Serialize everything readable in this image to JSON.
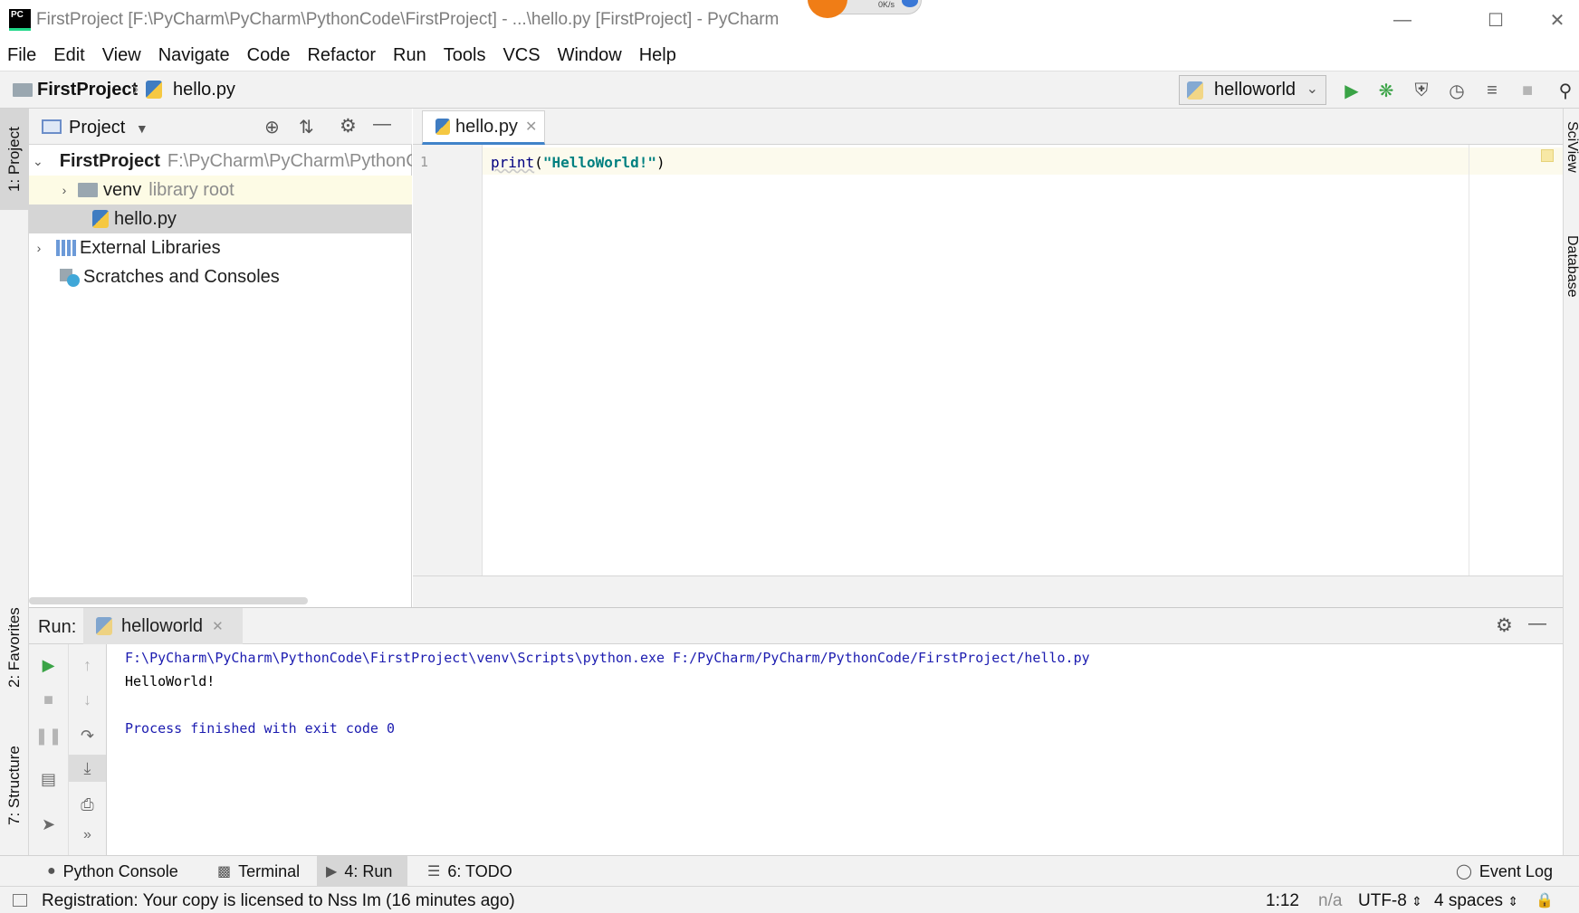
{
  "window": {
    "title": "FirstProject [F:\\PyCharm\\PyCharm\\PythonCode\\FirstProject] - ...\\hello.py [FirstProject] - PyCharm",
    "logo_text": "PC",
    "overlay_speed": "0K/s"
  },
  "menu": [
    "File",
    "Edit",
    "View",
    "Navigate",
    "Code",
    "Refactor",
    "Run",
    "Tools",
    "VCS",
    "Window",
    "Help"
  ],
  "navbar": {
    "project": "FirstProject",
    "file": "hello.py",
    "run_config": "helloworld"
  },
  "left_strip": {
    "project_tab": "1: Project",
    "favorites_tab": "2: Favorites",
    "structure_tab": "7: Structure"
  },
  "right_strip": {
    "sciview_tab": "SciView",
    "database_tab": "Database"
  },
  "project_panel": {
    "title": "Project",
    "tree": {
      "root_name": "FirstProject",
      "root_path": "F:\\PyCharm\\PyCharm\\PythonCode\\FirstProject",
      "venv_name": "venv",
      "venv_note": "library root",
      "file_name": "hello.py",
      "external": "External Libraries",
      "scratches": "Scratches and Consoles"
    }
  },
  "editor": {
    "tab_label": "hello.py",
    "line_number": "1",
    "code_fn": "print",
    "code_open": "(",
    "code_str": "\"HelloWorld!\"",
    "code_close": ")"
  },
  "run_panel": {
    "label": "Run:",
    "tab": "helloworld",
    "console": {
      "command": "F:\\PyCharm\\PyCharm\\PythonCode\\FirstProject\\venv\\Scripts\\python.exe F:/PyCharm/PyCharm/PythonCode/FirstProject/hello.py",
      "output": "HelloWorld!",
      "exit": "Process finished with exit code 0"
    }
  },
  "bottom_tabs": {
    "python_console": "Python Console",
    "terminal": "Terminal",
    "run": "4: Run",
    "todo": "6: TODO",
    "event_log": "Event Log"
  },
  "status": {
    "message": "Registration: Your copy is licensed to Nss Im (16 minutes ago)",
    "position": "1:12",
    "line_sep": "n/a",
    "encoding": "UTF-8",
    "indent": "4 spaces"
  },
  "colors": {
    "accent": "#4083c9",
    "run_green": "#3aa346",
    "console_blue": "#1c1cb0"
  }
}
